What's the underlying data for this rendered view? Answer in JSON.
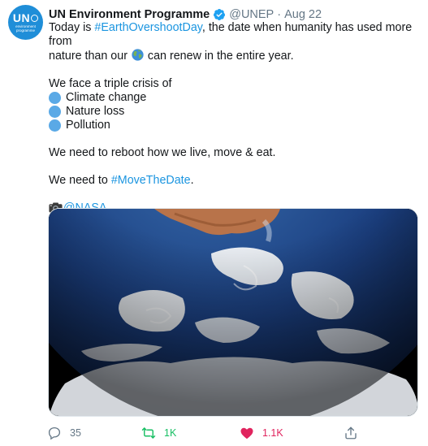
{
  "tweet": {
    "author_name": "UN Environment Programme",
    "handle": "@UNEP",
    "separator": "·",
    "date": "Aug 22",
    "avatar": {
      "logo_text": "UN",
      "logo_subtext_1": "environment",
      "logo_subtext_2": "programme"
    },
    "verified_icon": "verified-badge-icon",
    "text": {
      "line1_prefix": "Today is ",
      "hashtag1": "#EarthOvershootDay",
      "line1_suffix": ", the date when humanity has used more from",
      "line2_prefix": "nature than our ",
      "line2_emoji": "earth-globe-emoji",
      "line2_suffix": " can renew in the entire year.",
      "crisis_intro": "We face a triple crisis of",
      "crises": [
        "Climate change",
        "Nature loss",
        "Pollution"
      ],
      "reboot": "We need to reboot how we live, move & eat.",
      "move_prefix": "We need to ",
      "hashtag2": "#MoveTheDate",
      "move_suffix": ".",
      "credit_icon": "camera-emoji",
      "credit": "@NASA"
    },
    "media": {
      "description_icon": "earth-photo"
    },
    "actions": {
      "reply_count": "35",
      "retweet_count": "1K",
      "like_count": "1.1K"
    },
    "colors": {
      "link": "#1b95e0",
      "retweet": "#17bf63",
      "like": "#e0245e",
      "muted": "#657786",
      "bullet": "#5aa9e6"
    }
  }
}
